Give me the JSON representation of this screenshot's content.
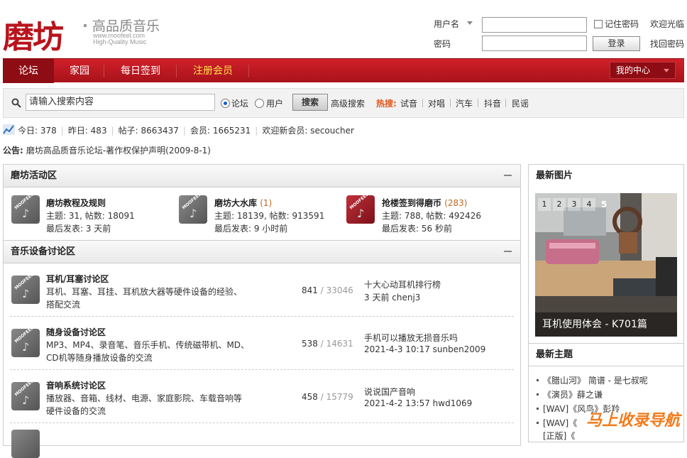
{
  "logo": {
    "brand": "磨坊",
    "tagline": "高品质音乐",
    "url": "www.moofeel.com",
    "hq": "High-Quality Music"
  },
  "login": {
    "username_label": "用户名",
    "password_label": "密码",
    "remember_label": "记住密码",
    "welcome": "欢迎光临",
    "forgot": "找回密码",
    "login_button": "登录"
  },
  "nav": {
    "items": [
      {
        "label": "论坛"
      },
      {
        "label": "家园"
      },
      {
        "label": "每日签到"
      },
      {
        "label": "注册会员"
      }
    ],
    "my_center": "我的中心",
    "register_color": "#ffe14d"
  },
  "search": {
    "placeholder": "请输入搜索内容",
    "options": [
      {
        "label": "论坛",
        "checked": true
      },
      {
        "label": "用户",
        "checked": false
      }
    ],
    "button": "搜索",
    "advanced": "高级搜索",
    "hot_label": "热搜:",
    "hot_items": [
      "试音",
      "对唱",
      "汽车",
      "抖音",
      "民谣"
    ]
  },
  "stats": {
    "today": "今日: 378",
    "yesterday": "昨日: 483",
    "posts": "帖子: 8663437",
    "members": "会员: 1665231",
    "welcome": "欢迎新会员: secoucher"
  },
  "notice": {
    "label": "公告:",
    "text": "磨坊高品质音乐论坛-著作权保护声明(2009-8-1)"
  },
  "activity": {
    "title": "磨坊活动区",
    "forums": [
      {
        "name": "磨坊教程及规则",
        "today": "",
        "stats": "主题: 31, 帖数: 18091",
        "last": "最后发表: 3 天前",
        "icon": "moofeel-icon"
      },
      {
        "name": "磨坊大水库",
        "today": "(1)",
        "stats": "主题: 18139, 帖数: 913591",
        "last": "最后发表: 9 小时前",
        "icon": "moofeel-icon"
      },
      {
        "name": "抢楼签到得磨币",
        "today": "(283)",
        "stats": "主题: 788, 帖数: 492426",
        "last": "最后发表: 56 秒前",
        "icon": "moofeel-red-icon"
      }
    ]
  },
  "music": {
    "title": "音乐设备讨论区",
    "forums": [
      {
        "name": "耳机/耳塞讨论区",
        "desc1": "耳机、耳塞、耳挂、耳机放大器等硬件设备的经验、",
        "desc2": "搭配交流",
        "threads": "841",
        "posts": "/ 33046",
        "last_title": "十大心动耳机排行榜",
        "last_info": "3 天前 chenj3"
      },
      {
        "name": "随身设备讨论区",
        "desc1": "MP3、MP4、录音笔、音乐手机、传统磁带机、MD、",
        "desc2": "CD机等随身播放设备的交流",
        "threads": "538",
        "posts": "/ 14631",
        "last_title": "手机可以播放无损音乐吗",
        "last_info": "2021-4-3 10:17 sunben2009"
      },
      {
        "name": "音响系统讨论区",
        "desc1": "播放器、音箱、线材、电源、家庭影院、车载音响等",
        "desc2": "硬件设备的交流",
        "threads": "458",
        "posts": "/ 15779",
        "last_title": "说说国产音响",
        "last_info": "2021-4-2 13:57 hwd1069"
      }
    ]
  },
  "latest_images": {
    "title": "最新图片",
    "pages": [
      "1",
      "2",
      "3",
      "4",
      "5"
    ],
    "active_page": "5",
    "caption": "耳机使用体会 - K701篇"
  },
  "latest_topics": {
    "title": "最新主题",
    "items": [
      "《腊山河》 简谱 - 是七叔呢",
      "《演员》薛之谦",
      "[WAV]《风鸟》彭羚",
      "[WAV]《",
      "[正版]《"
    ]
  },
  "watermark": "马上收录导航"
}
